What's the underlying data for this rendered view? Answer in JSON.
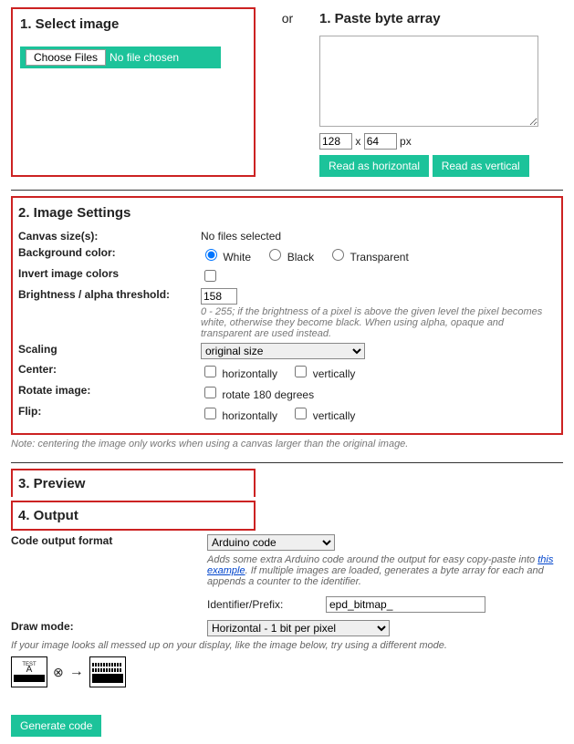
{
  "sections": {
    "select_image": {
      "title": "1. Select image",
      "choose_files_btn": "Choose Files",
      "no_file_chosen": "No file chosen"
    },
    "or": "or",
    "paste": {
      "title": "1. Paste byte array",
      "width": "128",
      "height": "64",
      "px": "px",
      "times": "x",
      "read_horizontal": "Read as horizontal",
      "read_vertical": "Read as vertical"
    },
    "image_settings": {
      "title": "2. Image Settings",
      "canvas_label": "Canvas size(s):",
      "canvas_value": "No files selected",
      "bgcolor_label": "Background color:",
      "bg_white": "White",
      "bg_black": "Black",
      "bg_transparent": "Transparent",
      "invert_label": "Invert image colors",
      "brightness_label": "Brightness / alpha threshold:",
      "brightness_value": "158",
      "brightness_hint": "0 - 255; if the brightness of a pixel is above the given level the pixel becomes white, otherwise they become black. When using alpha, opaque and transparent are used instead.",
      "scaling_label": "Scaling",
      "scaling_value": "original size",
      "center_label": "Center:",
      "center_h": "horizontally",
      "center_v": "vertically",
      "rotate_label": "Rotate image:",
      "rotate_180": "rotate 180 degrees",
      "flip_label": "Flip:",
      "flip_h": "horizontally",
      "flip_v": "vertically",
      "center_note": "Note: centering the image only works when using a canvas larger than the original image."
    },
    "preview": {
      "title": "3. Preview"
    },
    "output": {
      "title": "4. Output",
      "format_label": "Code output format",
      "format_value": "Arduino code",
      "format_hint_1": "Adds some extra Arduino code around the output for easy copy-paste into ",
      "format_hint_link": "this example",
      "format_hint_2": ". If multiple images are loaded, generates a byte array for each and appends a counter to the identifier.",
      "identifier_label": "Identifier/Prefix:",
      "identifier_value": "epd_bitmap_",
      "draw_mode_label": "Draw mode:",
      "draw_mode_value": "Horizontal - 1 bit per pixel",
      "draw_mode_hint": "If your image looks all messed up on your display, like the image below, try using a different mode.",
      "generate": "Generate code",
      "test_a": "TEST",
      "test_b": "A"
    }
  }
}
